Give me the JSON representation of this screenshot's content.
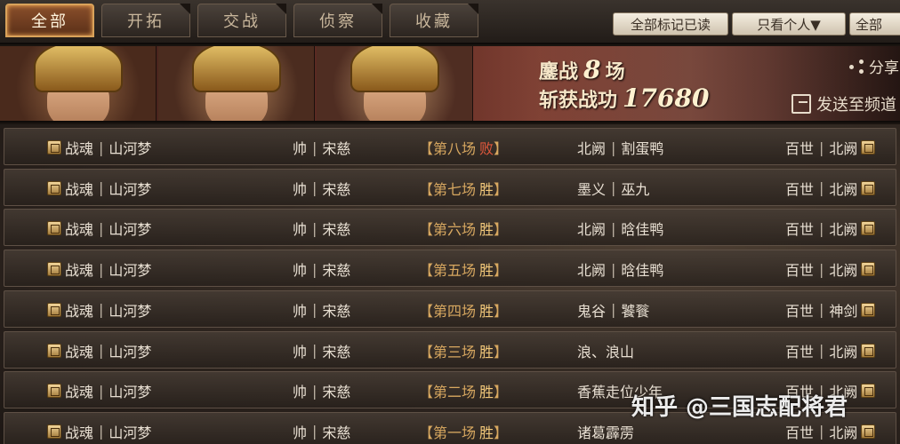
{
  "tabs": [
    {
      "label": "全部",
      "active": true
    },
    {
      "label": "开拓",
      "active": false
    },
    {
      "label": "交战",
      "active": false
    },
    {
      "label": "侦察",
      "active": false
    },
    {
      "label": "收藏",
      "active": false
    }
  ],
  "toolbar": {
    "mark_all_read": "全部标记已读",
    "filter_personal": "只看个人▼",
    "all": "全部"
  },
  "banner": {
    "battles_label": "鏖战",
    "battles_value": "8",
    "battles_unit": "场",
    "merit_label": "斩获战功",
    "merit_value": "17680",
    "share_label": "分享",
    "send_label": "发送至频道"
  },
  "reports": [
    {
      "left": "战魂",
      "left2": "山河梦",
      "mid": "帅",
      "mid2": "宋慈",
      "round": "第八场",
      "result": "败",
      "result_type": "lose",
      "opp": "北阙",
      "opp2": "割蛋鸭",
      "right": "百世",
      "right2": "北阙"
    },
    {
      "left": "战魂",
      "left2": "山河梦",
      "mid": "帅",
      "mid2": "宋慈",
      "round": "第七场",
      "result": "胜",
      "result_type": "win",
      "opp": "墨义",
      "opp2": "巫九",
      "right": "百世",
      "right2": "北阙"
    },
    {
      "left": "战魂",
      "left2": "山河梦",
      "mid": "帅",
      "mid2": "宋慈",
      "round": "第六场",
      "result": "胜",
      "result_type": "win",
      "opp": "北阙",
      "opp2": "晗佳鸭",
      "right": "百世",
      "right2": "北阙"
    },
    {
      "left": "战魂",
      "left2": "山河梦",
      "mid": "帅",
      "mid2": "宋慈",
      "round": "第五场",
      "result": "胜",
      "result_type": "win",
      "opp": "北阙",
      "opp2": "晗佳鸭",
      "right": "百世",
      "right2": "北阙"
    },
    {
      "left": "战魂",
      "left2": "山河梦",
      "mid": "帅",
      "mid2": "宋慈",
      "round": "第四场",
      "result": "胜",
      "result_type": "win",
      "opp": "鬼谷",
      "opp2": "饕餮",
      "right": "百世",
      "right2": "神剑"
    },
    {
      "left": "战魂",
      "left2": "山河梦",
      "mid": "帅",
      "mid2": "宋慈",
      "round": "第三场",
      "result": "胜",
      "result_type": "win",
      "opp": "浪、浪山",
      "opp2": "",
      "right": "百世",
      "right2": "北阙"
    },
    {
      "left": "战魂",
      "left2": "山河梦",
      "mid": "帅",
      "mid2": "宋慈",
      "round": "第二场",
      "result": "胜",
      "result_type": "win",
      "opp": "香蕉走位少年",
      "opp2": "",
      "right": "百世",
      "right2": "北阙"
    },
    {
      "left": "战魂",
      "left2": "山河梦",
      "mid": "帅",
      "mid2": "宋慈",
      "round": "第一场",
      "result": "胜",
      "result_type": "win",
      "opp": "诸葛霹雳",
      "opp2": "",
      "right": "百世",
      "right2": "北阙"
    }
  ],
  "watermark": "知乎 @三国志配将君"
}
